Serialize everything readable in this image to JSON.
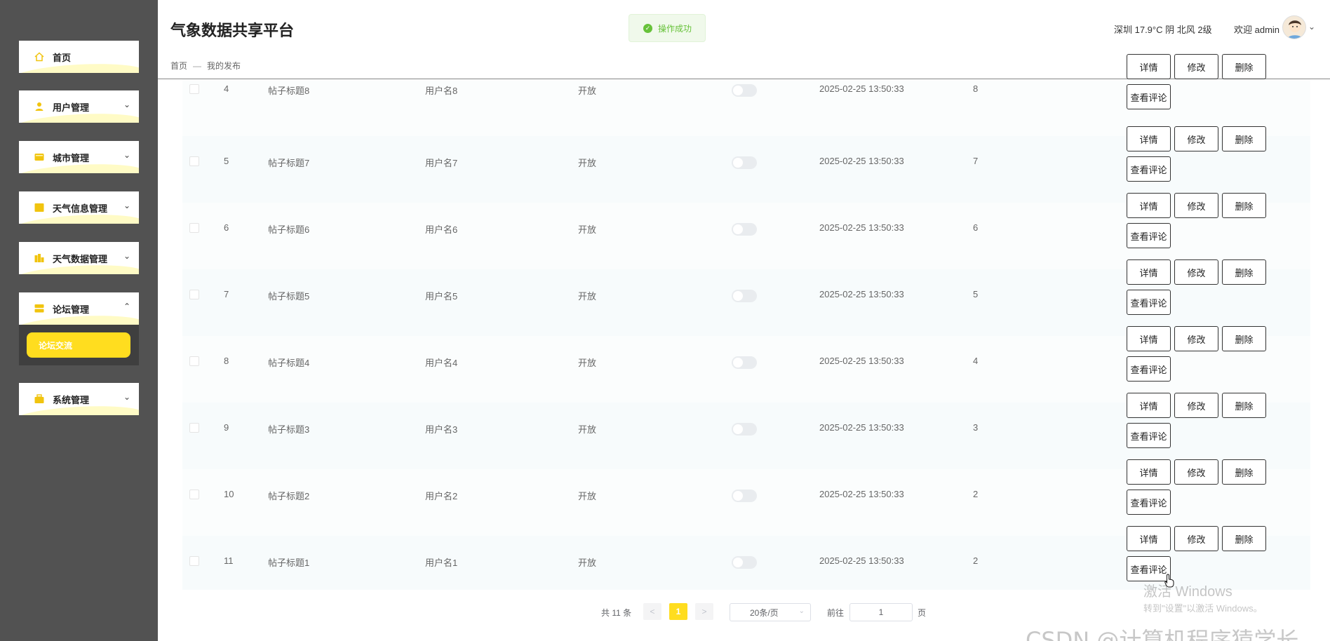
{
  "app": {
    "title": "气象数据共享平台"
  },
  "breadcrumb": {
    "home": "首页",
    "separator": "—",
    "current": "我的发布"
  },
  "toast": {
    "text": "操作成功",
    "icon": "check-circle-icon",
    "color": "#67c23a"
  },
  "header": {
    "weather": "深圳 17.9°C 阴 北风 2级",
    "welcome": "欢迎 admin",
    "avatar_icon": "user-avatar"
  },
  "sidebar": {
    "items": [
      {
        "label": "首页",
        "icon": "home-icon"
      },
      {
        "label": "用户管理",
        "icon": "user-icon"
      },
      {
        "label": "城市管理",
        "icon": "city-icon"
      },
      {
        "label": "天气信息管理",
        "icon": "weather-info-icon"
      },
      {
        "label": "天气数据管理",
        "icon": "weather-data-icon"
      },
      {
        "label": "论坛管理",
        "icon": "forum-icon"
      },
      {
        "label": "系统管理",
        "icon": "system-icon"
      }
    ],
    "subitem": "论坛交流",
    "accent": "#ffdd1f"
  },
  "table": {
    "rows": [
      {
        "index": "4",
        "title": "帖子标题8",
        "user": "用户名8",
        "status": "开放",
        "time": "2025-02-25 13:50:33",
        "count": "8"
      },
      {
        "index": "5",
        "title": "帖子标题7",
        "user": "用户名7",
        "status": "开放",
        "time": "2025-02-25 13:50:33",
        "count": "7"
      },
      {
        "index": "6",
        "title": "帖子标题6",
        "user": "用户名6",
        "status": "开放",
        "time": "2025-02-25 13:50:33",
        "count": "6"
      },
      {
        "index": "7",
        "title": "帖子标题5",
        "user": "用户名5",
        "status": "开放",
        "time": "2025-02-25 13:50:33",
        "count": "5"
      },
      {
        "index": "8",
        "title": "帖子标题4",
        "user": "用户名4",
        "status": "开放",
        "time": "2025-02-25 13:50:33",
        "count": "4"
      },
      {
        "index": "9",
        "title": "帖子标题3",
        "user": "用户名3",
        "status": "开放",
        "time": "2025-02-25 13:50:33",
        "count": "3"
      },
      {
        "index": "10",
        "title": "帖子标题2",
        "user": "用户名2",
        "status": "开放",
        "time": "2025-02-25 13:50:33",
        "count": "2"
      },
      {
        "index": "11",
        "title": "帖子标题1",
        "user": "用户名1",
        "status": "开放",
        "time": "2025-02-25 13:50:33",
        "count": "2"
      }
    ],
    "actions": {
      "detail": "详情",
      "edit": "修改",
      "delete": "删除",
      "comments": "查看评论"
    }
  },
  "pagination": {
    "total": "共 11 条",
    "prev": "<",
    "current_page": "1",
    "next": ">",
    "page_size": "20条/页",
    "goto_label": "前往",
    "goto_value": "1",
    "page_suffix": "页"
  },
  "overlay": {
    "windows_activate": "激活 Windows",
    "windows_activate_sub": "转到\"设置\"以激活 Windows。",
    "watermark": "CSDN @计算机程序猿学长"
  }
}
